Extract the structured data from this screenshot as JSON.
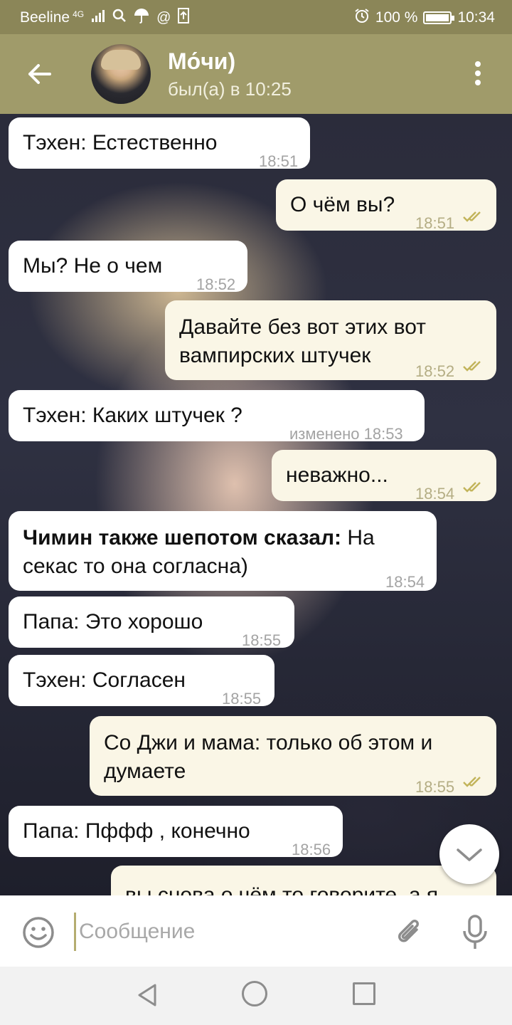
{
  "status_bar": {
    "carrier": "Beeline",
    "network": "4G",
    "battery": "100 %",
    "battery_level": 1.0,
    "time": "10:34"
  },
  "header": {
    "title": "Мо́чи)",
    "status": "был(а) в 10:25"
  },
  "messages": [
    {
      "dir": "in",
      "text": "Тэхен: Естественно",
      "time": "18:51"
    },
    {
      "dir": "out",
      "text": "О чём вы?",
      "time": "18:51",
      "read": true
    },
    {
      "dir": "in",
      "text": "Мы? Не о чем",
      "time": "18:52"
    },
    {
      "dir": "out",
      "text": "Давайте без вот этих вот\nвампирских штучек",
      "time": "18:52",
      "read": true
    },
    {
      "dir": "in",
      "text": "Тэхен: Каких штучек ?",
      "time": "изменено 18:53"
    },
    {
      "dir": "out",
      "text": "неважно...",
      "time": "18:54",
      "read": true
    },
    {
      "dir": "in",
      "bold_prefix": "Чимин также шепотом сказал:",
      "text": " На\nсекас то она согласна)",
      "time": "18:54"
    },
    {
      "dir": "in",
      "text": "Папа: Это хорошо",
      "time": "18:55"
    },
    {
      "dir": "in",
      "text": "Тэхен: Согласен",
      "time": "18:55"
    },
    {
      "dir": "out",
      "text": "Со Джи и мама: только об этом и\nдумаете",
      "time": "18:55",
      "read": true
    },
    {
      "dir": "in",
      "text": "Папа: Пффф , конечно",
      "time": "18:56"
    },
    {
      "dir": "out",
      "text": "вы снова о чём то говорите, а я",
      "time": ""
    }
  ],
  "input": {
    "placeholder": "Сообщение"
  },
  "icons": {
    "back": "arrow-left",
    "menu": "more-vertical",
    "emoji": "smiley",
    "attach": "paperclip",
    "mic": "microphone",
    "scroll_down": "chevron-down"
  },
  "colors": {
    "header": "#a09b6a",
    "statusbar": "#8b8658",
    "outgoing_bubble": "#faf6e6",
    "incoming_bubble": "#ffffff",
    "read_check": "#c2b45a"
  }
}
